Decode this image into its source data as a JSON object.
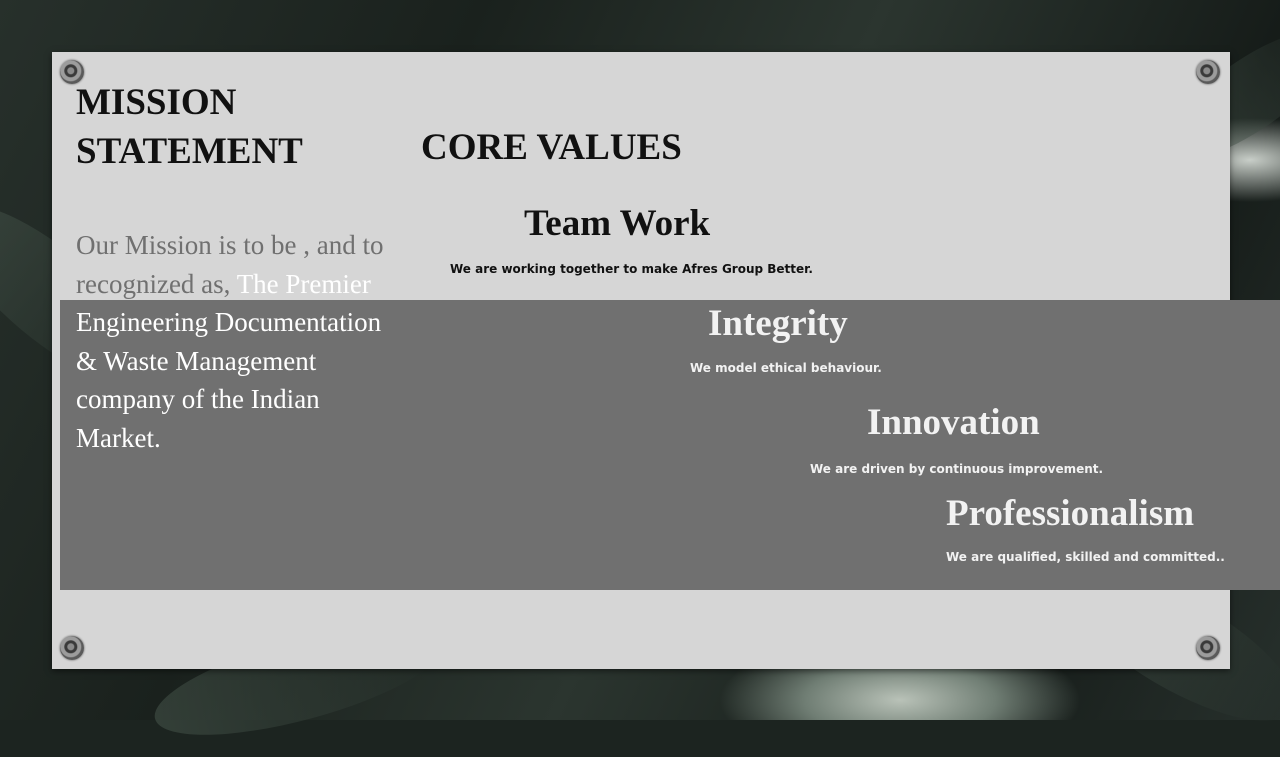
{
  "mission": {
    "title_line1": "MISSION",
    "title_line2": "STATEMENT",
    "body_dim": "Our Mission is to be , and to recognized as, ",
    "body_light": "The Premier Engineering Documentation & Waste Management company of the Indian Market."
  },
  "core_values": {
    "title": "CORE VALUES",
    "items": [
      {
        "name": "Team Work",
        "description": "We are working together to make Afres Group Better."
      },
      {
        "name": "Integrity",
        "description": "We model ethical behaviour."
      },
      {
        "name": "Innovation",
        "description": "We are driven by continuous improvement."
      },
      {
        "name": "Professionalism",
        "description": "We are qualified, skilled and committed.."
      }
    ]
  }
}
